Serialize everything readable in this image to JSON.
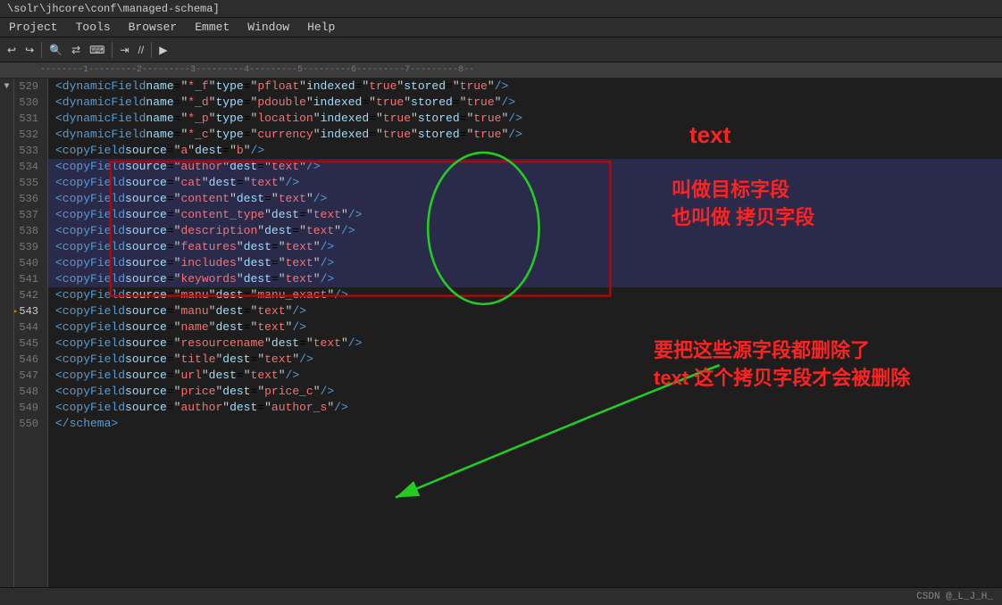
{
  "titleBar": {
    "text": "\\solr\\jhcore\\conf\\managed-schema]"
  },
  "menuBar": {
    "items": [
      "Project",
      "Tools",
      "Browser",
      "Emmet",
      "Window",
      "Help"
    ]
  },
  "ruler": {
    "text": "----1----2----3----4----5----6----7----8--"
  },
  "lines": [
    {
      "num": 529,
      "content": "    <dynamicField name=\"*_f\"  type=\"pfloat\"   indexed=\"true\" stored=\"true\"/>",
      "highlighted": false,
      "arrow": false
    },
    {
      "num": 530,
      "content": "    <dynamicField name=\"*_d\"  type=\"pdouble\"  indexed=\"true\" stored=\"true\"/>",
      "highlighted": false,
      "arrow": false
    },
    {
      "num": 531,
      "content": "    <dynamicField name=\"*_p\"  type=\"location\" indexed=\"true\" stored=\"true\"/>",
      "highlighted": false,
      "arrow": false
    },
    {
      "num": 532,
      "content": "    <dynamicField name=\"*_c\"  type=\"currency\" indexed=\"true\" stored=\"true\"/>",
      "highlighted": false,
      "arrow": false
    },
    {
      "num": 533,
      "content": "    <copyField source=\"a\"  dest=\"b\"/>",
      "highlighted": false,
      "arrow": false
    },
    {
      "num": 534,
      "content": "    <copyField source=\"author\" dest=\"text\"/>",
      "highlighted": true,
      "arrow": false
    },
    {
      "num": 535,
      "content": "    <copyField source=\"cat\" dest=\"text\"/>",
      "highlighted": true,
      "arrow": false
    },
    {
      "num": 536,
      "content": "    <copyField source=\"content\" dest=\"text\"/>",
      "highlighted": true,
      "arrow": false
    },
    {
      "num": 537,
      "content": "    <copyField source=\"content_type\" dest=\"text\"/>",
      "highlighted": true,
      "arrow": false
    },
    {
      "num": 538,
      "content": "    <copyField source=\"description\" dest=\"text\"/>",
      "highlighted": true,
      "arrow": false
    },
    {
      "num": 539,
      "content": "    <copyField source=\"features\" dest=\"text\"/>",
      "highlighted": true,
      "arrow": false
    },
    {
      "num": 540,
      "content": "    <copyField source=\"includes\" dest=\"text\"/>",
      "highlighted": true,
      "arrow": false
    },
    {
      "num": 541,
      "content": "    <copyField source=\"keywords\" dest=\"text\"/>",
      "highlighted": true,
      "arrow": false
    },
    {
      "num": 542,
      "content": "    <copyField source=\"manu\" dest=\"manu_exact\"/>",
      "highlighted": false,
      "arrow": false
    },
    {
      "num": 543,
      "content": "    <copyField source=\"manu\" dest=\"text\"/>",
      "highlighted": false,
      "arrow": true
    },
    {
      "num": 544,
      "content": "    <copyField source=\"name\" dest=\"text\"/>",
      "highlighted": false,
      "arrow": false
    },
    {
      "num": 545,
      "content": "    <copyField source=\"resourcename\" dest=\"text\"/>",
      "highlighted": false,
      "arrow": false
    },
    {
      "num": 546,
      "content": "    <copyField source=\"title\" dest=\"text\"/>",
      "highlighted": false,
      "arrow": false
    },
    {
      "num": 547,
      "content": "    <copyField source=\"url\" dest=\"text\"/>",
      "highlighted": false,
      "arrow": false
    },
    {
      "num": 548,
      "content": "    <copyField source=\"price\" dest=\"price_c\"/>",
      "highlighted": false,
      "arrow": false
    },
    {
      "num": 549,
      "content": "    <copyField source=\"author\" dest=\"author_s\"/>",
      "highlighted": false,
      "arrow": false
    },
    {
      "num": 550,
      "content": "  </schema>",
      "highlighted": false,
      "arrow": false
    }
  ],
  "annotations": {
    "text1": "text",
    "text2": "叫做目标字段\n也叫做 拷贝字段",
    "text3": "要把这些源字段都删除了\ntext 这个拷贝字段才会被删除"
  },
  "statusBar": {
    "text": "CSDN @_L_J_H_"
  }
}
